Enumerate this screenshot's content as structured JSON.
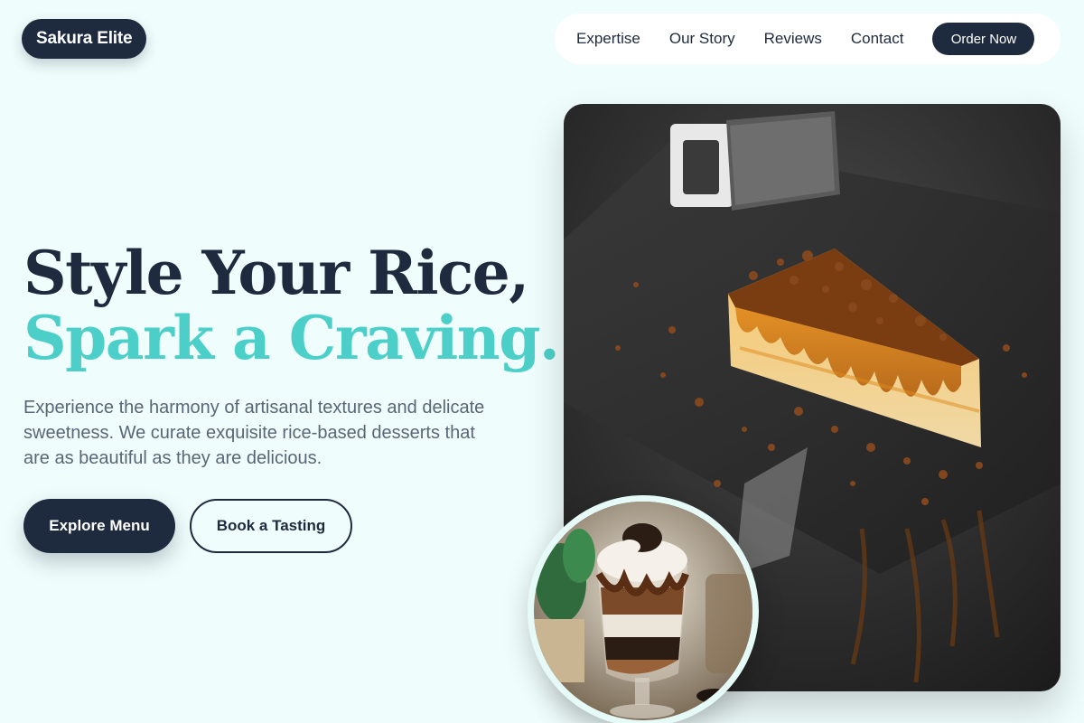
{
  "brand": {
    "name": "Sakura Elite"
  },
  "nav": {
    "links": [
      "Expertise",
      "Our Story",
      "Reviews",
      "Contact"
    ],
    "cta": "Order Now"
  },
  "hero": {
    "headline_line1": "Style Your Rice,",
    "headline_line2": "Spark a Craving.",
    "description": "Experience the harmony of artisanal textures and delicate sweetness. We curate exquisite rice-based desserts that are as beautiful as they are delicious.",
    "primary_button": "Explore Menu",
    "secondary_button": "Book a Tasting"
  },
  "colors": {
    "background": "#effdfc",
    "navy": "#1e2a3e",
    "accent_teal": "#4ccfc8",
    "body_text": "#5a6677"
  },
  "images": {
    "main": "caramel-cheesecake-photo",
    "inset": "chocolate-parfait-photo"
  }
}
